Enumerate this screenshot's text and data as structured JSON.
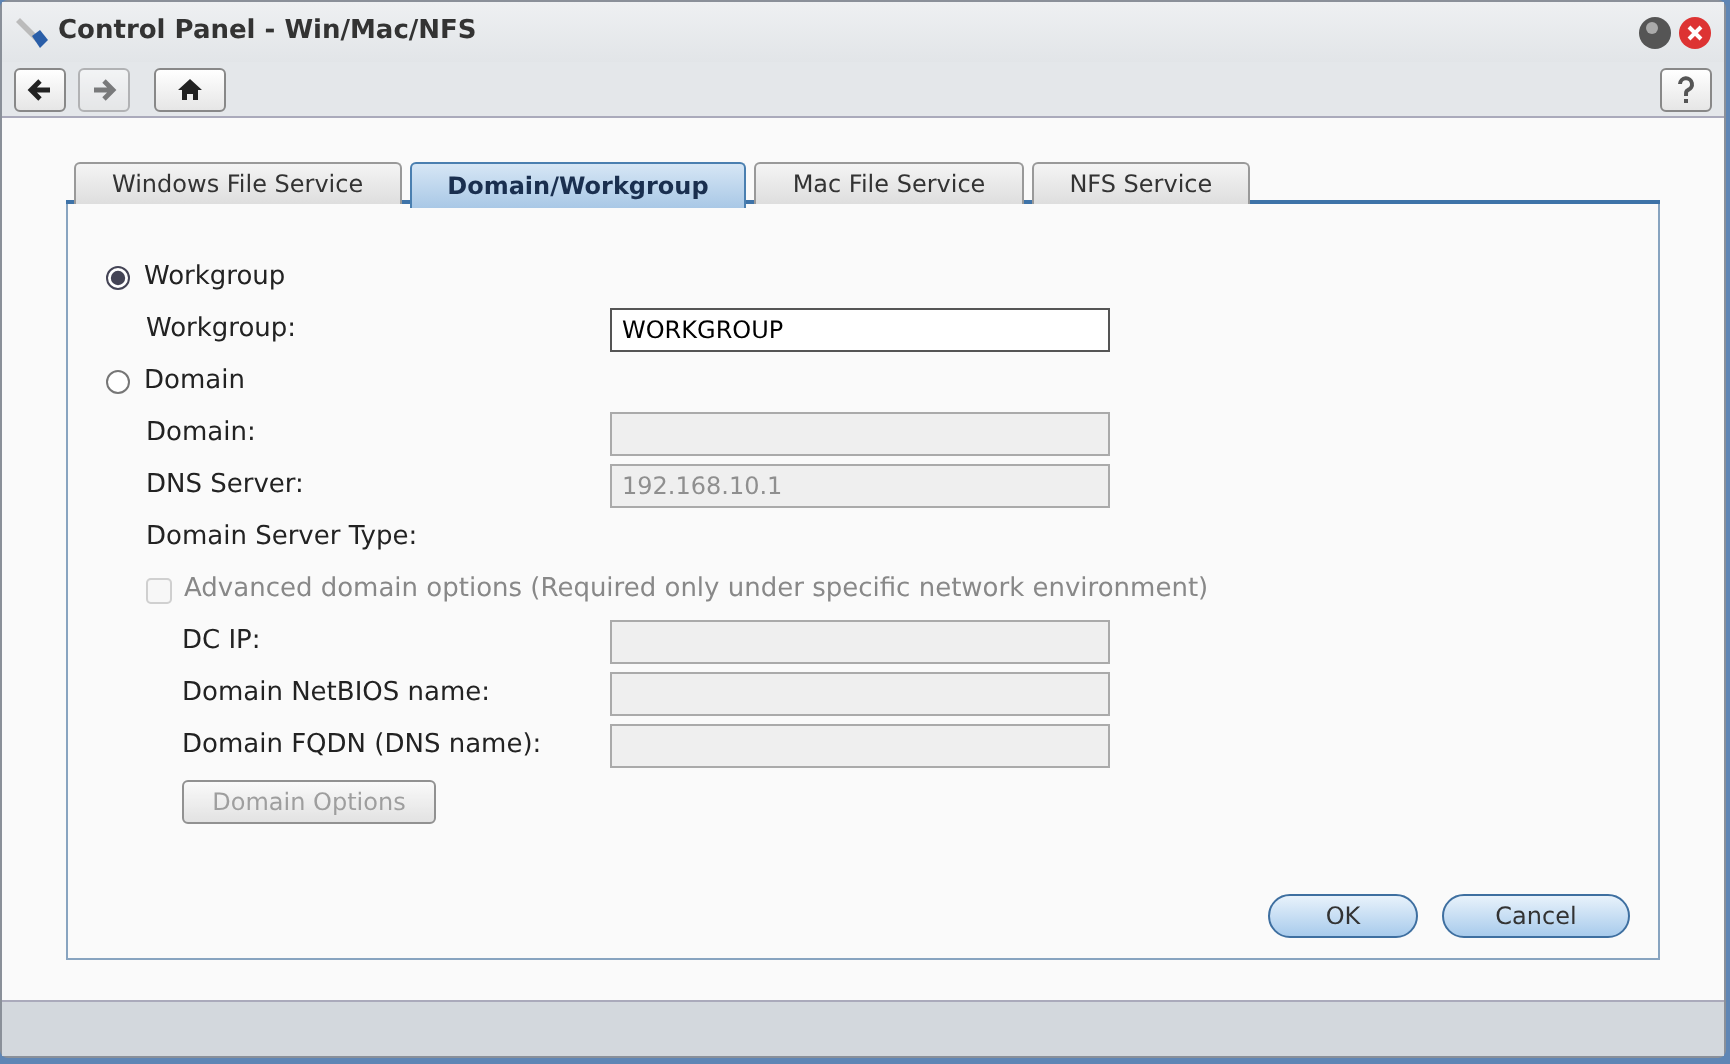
{
  "window": {
    "title": "Control Panel - Win/Mac/NFS"
  },
  "toolbar": [
    {
      "kind": "back",
      "disabled": false
    },
    {
      "kind": "forward",
      "disabled": true
    },
    {
      "kind": "home",
      "disabled": false
    }
  ],
  "tabs": [
    {
      "label": "Windows File Service",
      "selected": false
    },
    {
      "label": "Domain/Workgroup",
      "selected": true
    },
    {
      "label": "Mac File Service",
      "selected": false
    },
    {
      "label": "NFS Service",
      "selected": false
    }
  ],
  "options": [
    {
      "label": "Workgroup",
      "selected": true,
      "fields": [
        {
          "kind": "text",
          "label": "Workgroup:",
          "value": "WORKGROUP",
          "disabled": false
        }
      ]
    },
    {
      "label": "Domain",
      "selected": false,
      "fields": [
        {
          "kind": "text",
          "label": "Domain:",
          "disabled": true
        },
        {
          "kind": "text",
          "label": "DNS Server:",
          "value": "192.168.10.1",
          "disabled": true
        },
        {
          "kind": "label",
          "label": "Domain Server Type:"
        }
      ]
    }
  ],
  "advanced": {
    "label": "Advanced domain options (Required only under specific network environment)",
    "checked": false,
    "disabled": true,
    "fields": [
      {
        "kind": "text",
        "label": "DC IP:",
        "disabled": true
      },
      {
        "kind": "text",
        "label": "Domain NetBIOS name:",
        "disabled": true
      },
      {
        "kind": "text",
        "label": "Domain FQDN (DNS name):",
        "disabled": true
      }
    ]
  },
  "domain_options_button": {
    "label": "Domain Options",
    "disabled": true
  },
  "buttons": [
    {
      "label": "OK"
    },
    {
      "label": "Cancel"
    }
  ]
}
